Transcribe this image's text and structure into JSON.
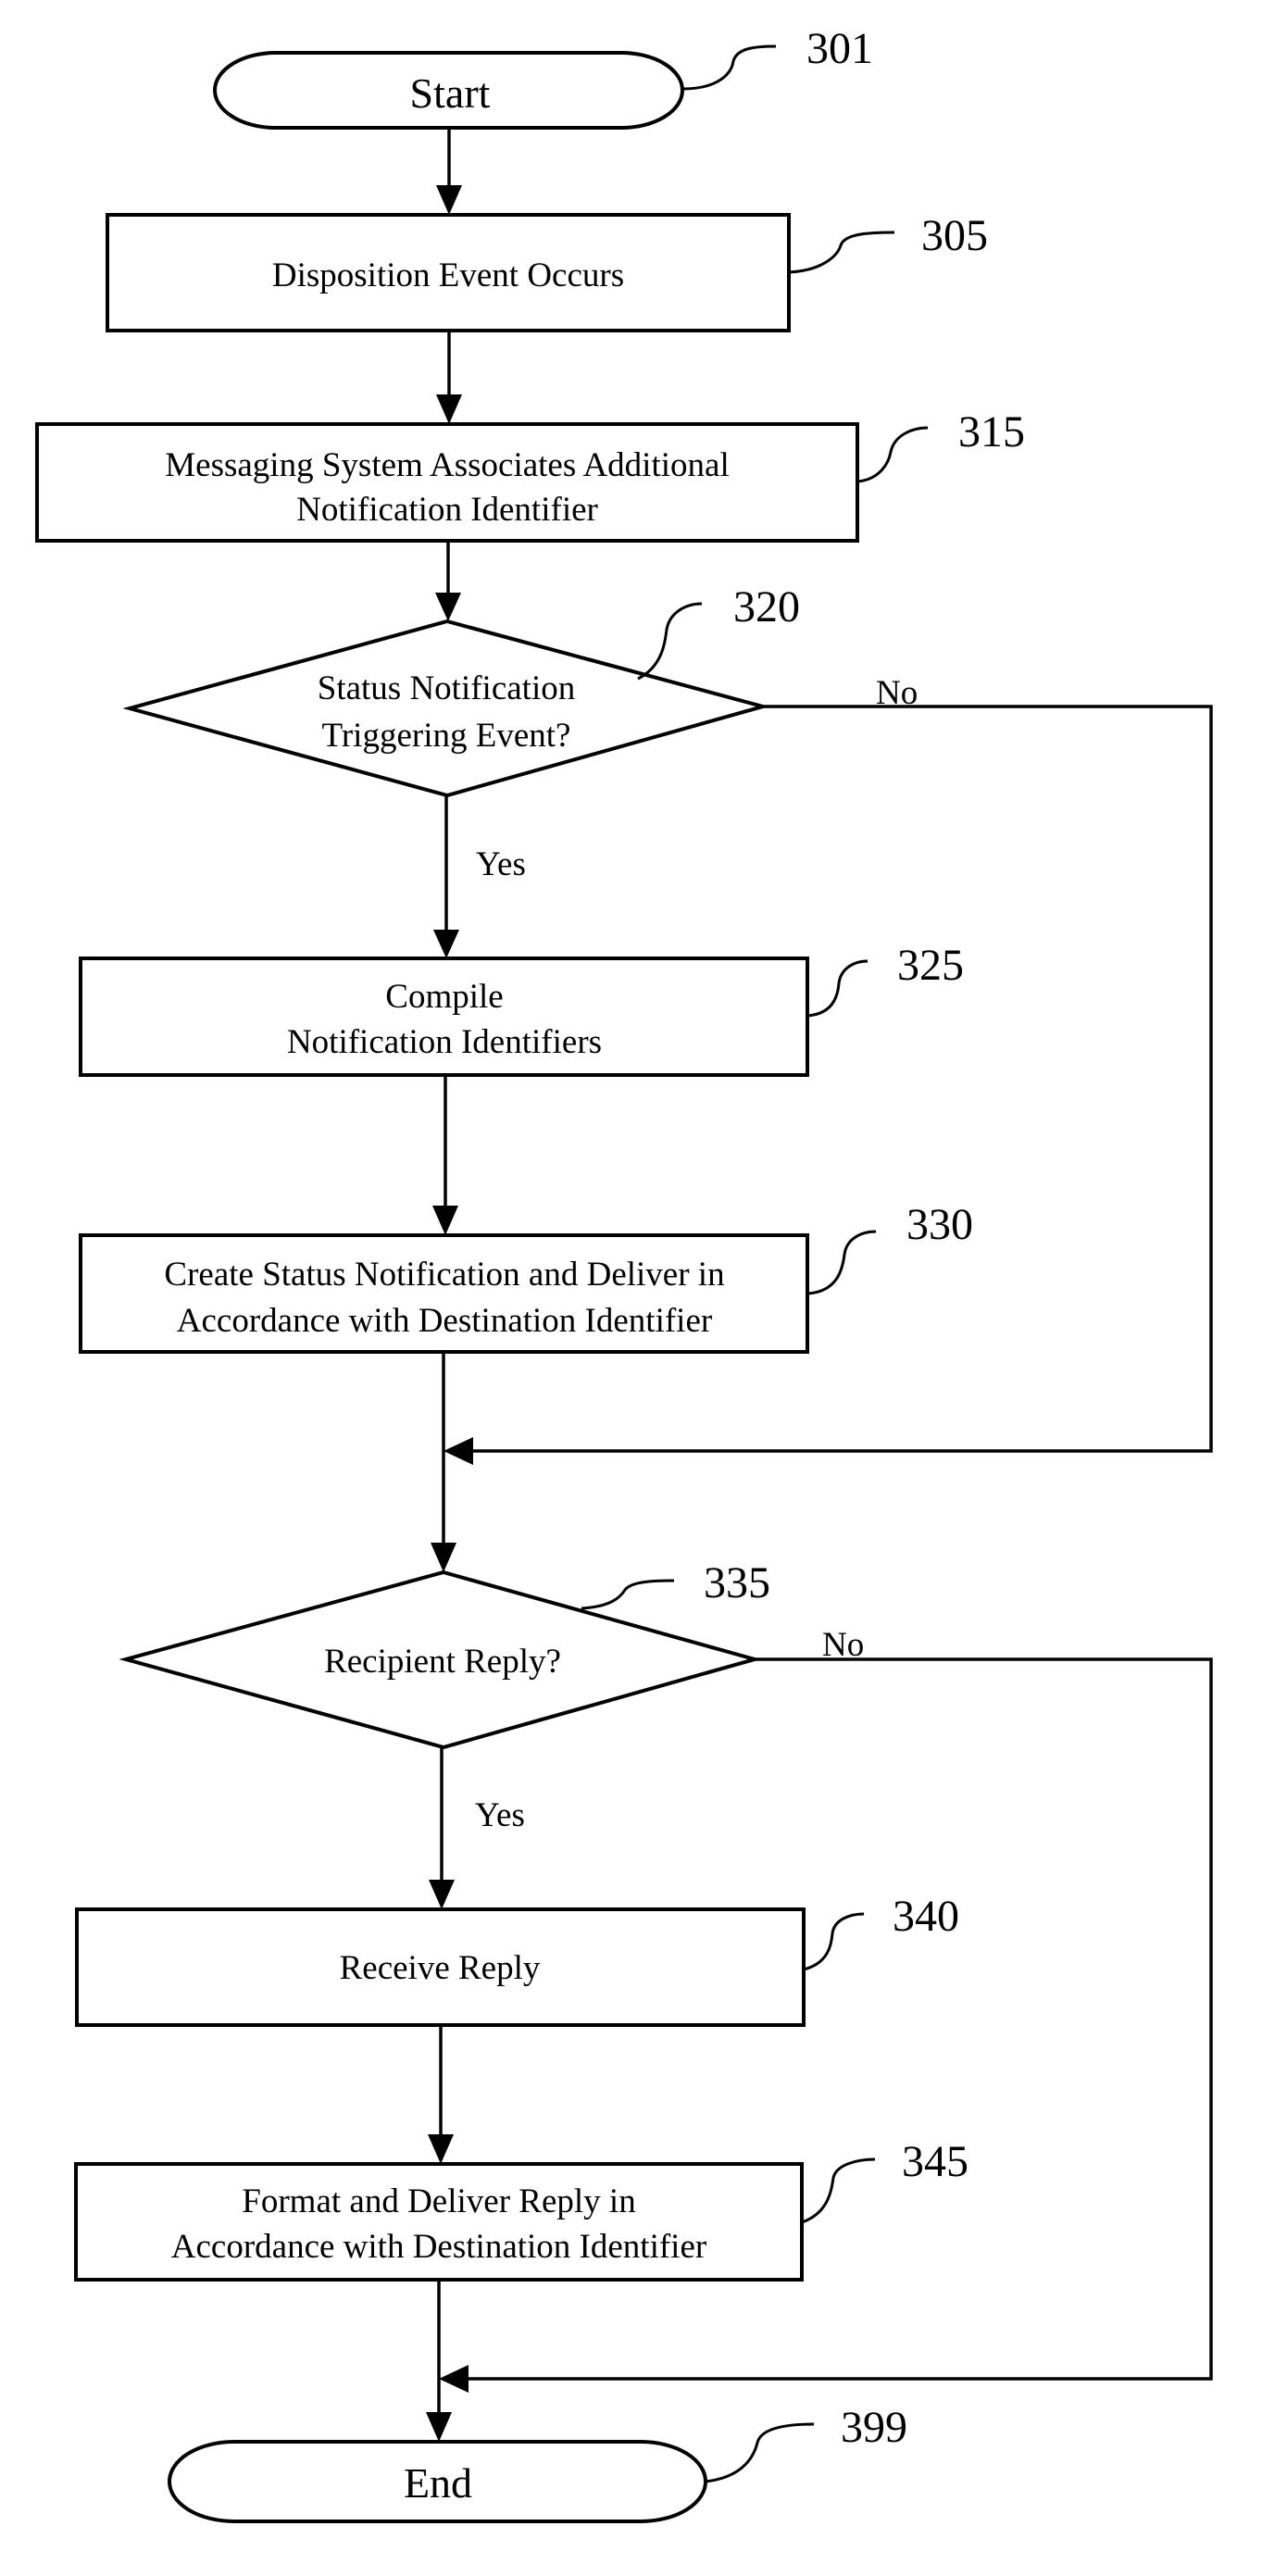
{
  "figure": {
    "nodes": {
      "start": {
        "ref": "301",
        "lines": [
          "Start"
        ]
      },
      "s305": {
        "ref": "305",
        "lines": [
          "Disposition Event Occurs"
        ]
      },
      "s315": {
        "ref": "315",
        "lines": [
          "Messaging System Associates Additional",
          "Notification Identifier"
        ]
      },
      "d320": {
        "ref": "320",
        "lines": [
          "Status Notification",
          "Triggering Event?"
        ]
      },
      "s325": {
        "ref": "325",
        "lines": [
          "Compile",
          "Notification Identifiers"
        ]
      },
      "s330": {
        "ref": "330",
        "lines": [
          "Create Status Notification and Deliver in",
          "Accordance with Destination Identifier"
        ]
      },
      "d335": {
        "ref": "335",
        "lines": [
          "Recipient Reply?"
        ]
      },
      "s340": {
        "ref": "340",
        "lines": [
          "Receive Reply"
        ]
      },
      "s345": {
        "ref": "345",
        "lines": [
          "Format and Deliver Reply in",
          "Accordance with Destination Identifier"
        ]
      },
      "end": {
        "ref": "399",
        "lines": [
          "End"
        ]
      }
    },
    "branches": {
      "d320_yes": "Yes",
      "d320_no": "No",
      "d335_yes": "Yes",
      "d335_no": "No"
    },
    "edges": [
      {
        "from": "start",
        "to": "s305"
      },
      {
        "from": "s305",
        "to": "s315"
      },
      {
        "from": "s315",
        "to": "d320"
      },
      {
        "from": "d320",
        "to": "s325",
        "label": "Yes"
      },
      {
        "from": "d320",
        "to": "d335",
        "label": "No"
      },
      {
        "from": "s325",
        "to": "s330"
      },
      {
        "from": "s330",
        "to": "d335"
      },
      {
        "from": "d335",
        "to": "s340",
        "label": "Yes"
      },
      {
        "from": "d335",
        "to": "end",
        "label": "No"
      },
      {
        "from": "s340",
        "to": "s345"
      },
      {
        "from": "s345",
        "to": "end"
      }
    ]
  }
}
